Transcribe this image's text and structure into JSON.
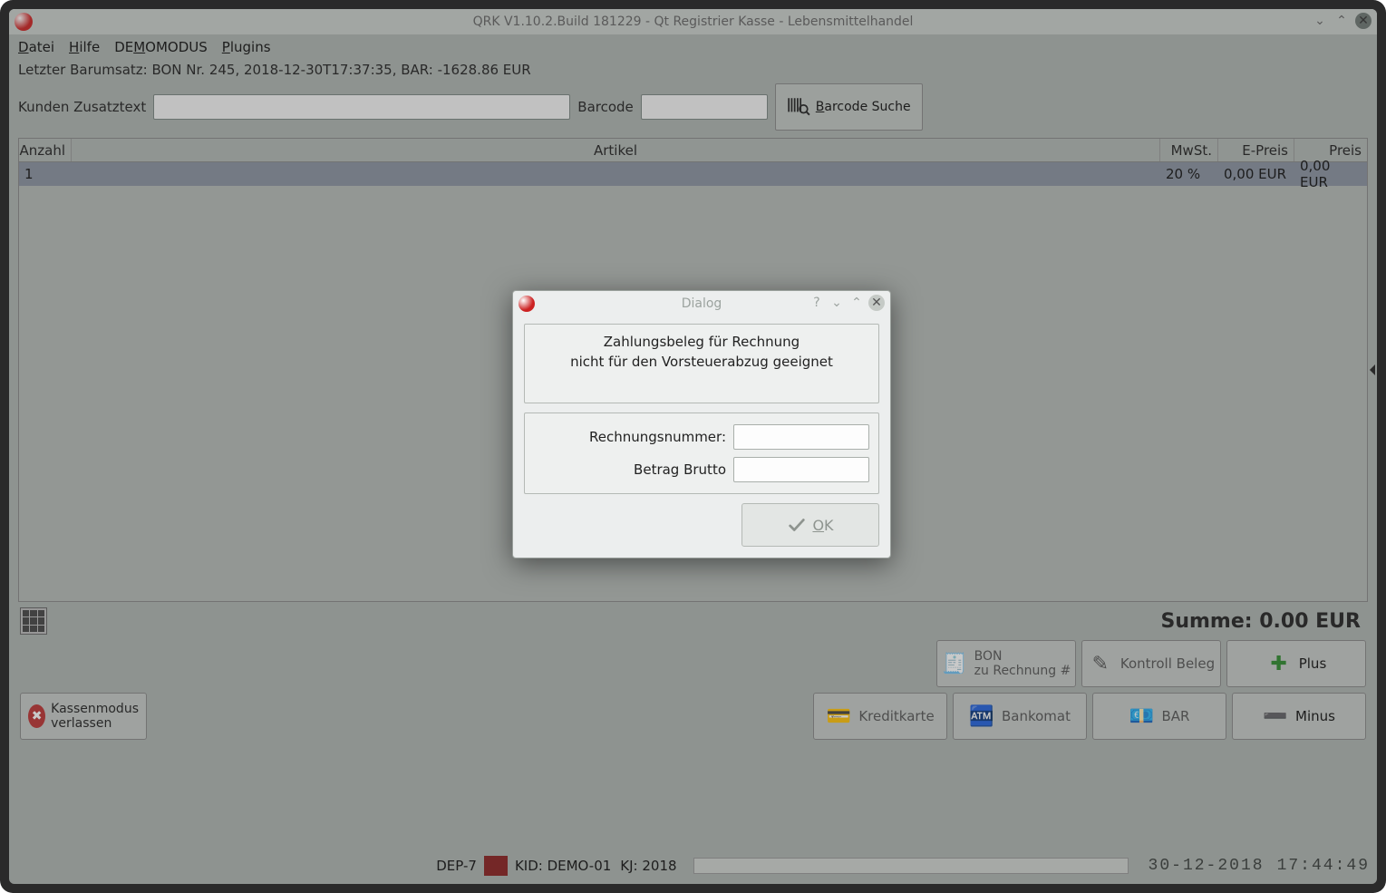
{
  "titlebar": {
    "title": "QRK V1.10.2.Build 181229 - Qt Registrier Kasse - Lebensmittelhandel"
  },
  "menu": {
    "datei": "Datei",
    "hilfe": "Hilfe",
    "demo": "DEMOMODUS",
    "demo_ul": "M",
    "plugins": "Plugins"
  },
  "topinfo": "Letzter Barumsatz: BON Nr. 245, 2018-12-30T17:37:35, BAR: -1628.86 EUR",
  "labels": {
    "kunden": "Kunden Zusatztext",
    "barcode": "Barcode",
    "barcode_search": "Barcode Suche"
  },
  "inputs": {
    "kunden_value": "",
    "barcode_value": ""
  },
  "table": {
    "headers": {
      "anzahl": "Anzahl",
      "artikel": "Artikel",
      "mwst": "MwSt.",
      "epreis": "E-Preis",
      "preis": "Preis"
    },
    "rows": [
      {
        "anzahl": "1",
        "artikel": "",
        "mwst": "20 %",
        "epreis": "0,00 EUR",
        "preis": "0,00 EUR"
      }
    ]
  },
  "summe_label": "Summe: 0.00 EUR",
  "buttons": {
    "bon_l1": "BON",
    "bon_l2": "zu Rechnung #",
    "kontroll": "Kontroll Beleg",
    "plus": "Plus",
    "kredit": "Kreditkarte",
    "banko": "Bankomat",
    "bar": "BAR",
    "minus": "Minus",
    "exit_l1": "Kassenmodus",
    "exit_l2": "verlassen"
  },
  "status": {
    "dep": "DEP-7",
    "kid": "KID: DEMO-01",
    "kj": "KJ: 2018",
    "date": "30-12-2018",
    "time": "17:44:49"
  },
  "dialog": {
    "title": "Dialog",
    "line1": "Zahlungsbeleg für Rechnung",
    "line2": "nicht für den Vorsteuerabzug geeignet",
    "rechnr_label": "Rechnungsnummer:",
    "brutto_label": "Betrag Brutto",
    "rechnr_value": "",
    "brutto_value": "",
    "ok": "OK"
  }
}
